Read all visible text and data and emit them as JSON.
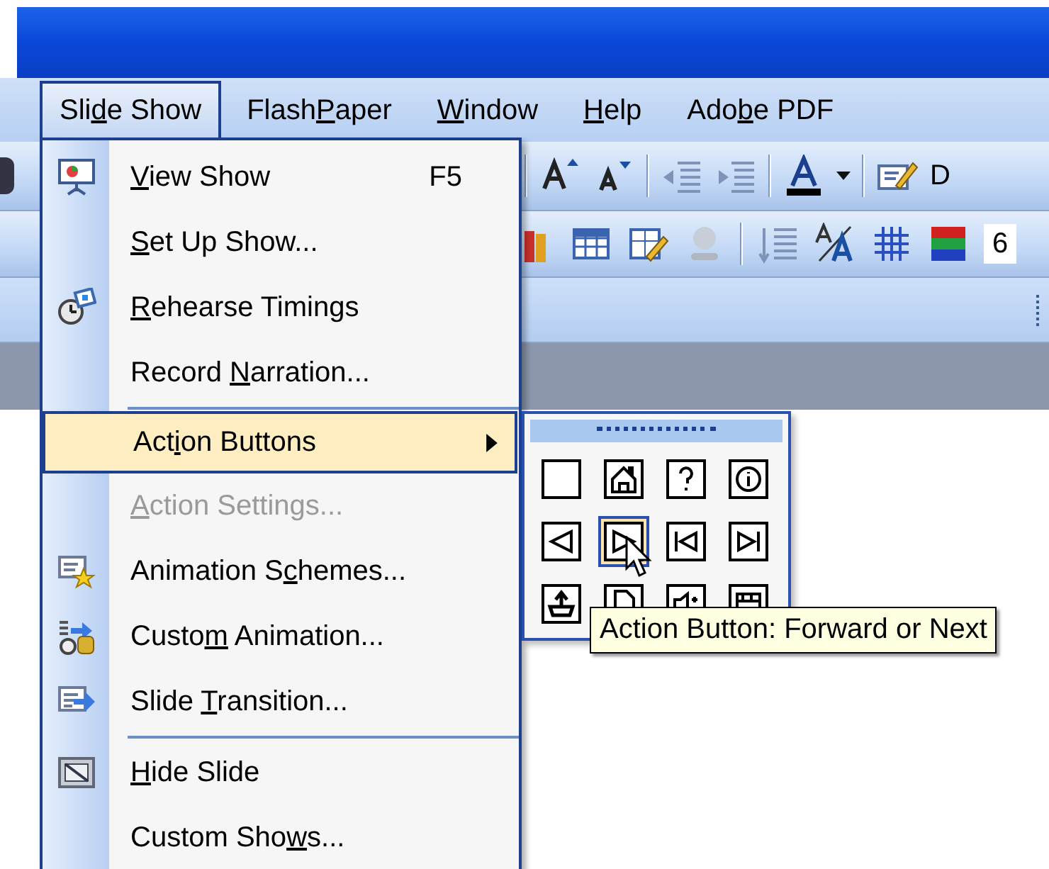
{
  "menu_bar": [
    {
      "label": {
        "pre": "Sli",
        "key": "d",
        "post": "e Show"
      },
      "selected": true
    },
    {
      "label": {
        "pre": "Flash",
        "key": "P",
        "post": "aper"
      },
      "selected": false
    },
    {
      "label": {
        "key": "W",
        "post": "indow"
      },
      "selected": false
    },
    {
      "label": {
        "key": "H",
        "post": "elp"
      },
      "selected": false
    },
    {
      "label": {
        "pre": "Ado",
        "key": "b",
        "post": "e PDF"
      },
      "selected": false
    }
  ],
  "toolbar_text": "D",
  "toolbar_2_text": "6",
  "menu": [
    {
      "kind": "item",
      "label": {
        "key": "V",
        "post": "iew Show"
      },
      "shortcut": "F5",
      "disabled": false,
      "selected": false,
      "submenu": false
    },
    {
      "kind": "item",
      "label": {
        "key": "S",
        "post": "et Up Show..."
      },
      "disabled": false,
      "selected": false,
      "submenu": false
    },
    {
      "kind": "item",
      "label": {
        "key": "R",
        "post": "ehearse Timings"
      },
      "disabled": false,
      "selected": false,
      "submenu": false
    },
    {
      "kind": "item",
      "label": {
        "pre": "Record ",
        "key": "N",
        "post": "arration..."
      },
      "disabled": false,
      "selected": false,
      "submenu": false
    },
    {
      "kind": "separator"
    },
    {
      "kind": "item",
      "label": {
        "pre": "Act",
        "key": "i",
        "post": "on Buttons"
      },
      "disabled": false,
      "selected": true,
      "submenu": true
    },
    {
      "kind": "item",
      "label": {
        "key": "A",
        "post": "ction Settings..."
      },
      "disabled": true,
      "selected": false,
      "submenu": false
    },
    {
      "kind": "item",
      "label": {
        "pre": "Animation S",
        "key": "c",
        "post": "hemes..."
      },
      "disabled": false,
      "selected": false,
      "submenu": false
    },
    {
      "kind": "item",
      "label": {
        "pre": "Custo",
        "key": "m",
        "post": " Animation..."
      },
      "disabled": false,
      "selected": false,
      "submenu": false
    },
    {
      "kind": "item",
      "label": {
        "pre": "Slide ",
        "key": "T",
        "post": "ransition..."
      },
      "disabled": false,
      "selected": false,
      "submenu": false
    },
    {
      "kind": "separator"
    },
    {
      "kind": "item",
      "label": {
        "key": "H",
        "post": "ide Slide"
      },
      "disabled": false,
      "selected": false,
      "submenu": false
    },
    {
      "kind": "item",
      "label": {
        "pre": "Custom Sho",
        "key": "w",
        "post": "s..."
      },
      "disabled": false,
      "selected": false,
      "submenu": false
    }
  ],
  "palette": {
    "buttons": [
      {
        "selected": false
      },
      {
        "selected": false
      },
      {
        "selected": false
      },
      {
        "selected": false
      },
      {
        "selected": false
      },
      {
        "selected": true
      },
      {
        "selected": false
      },
      {
        "selected": false
      },
      {
        "selected": false
      },
      {
        "selected": false
      },
      {
        "selected": false
      },
      {
        "selected": false
      }
    ]
  },
  "tooltip": "Action Button: Forward or Next"
}
